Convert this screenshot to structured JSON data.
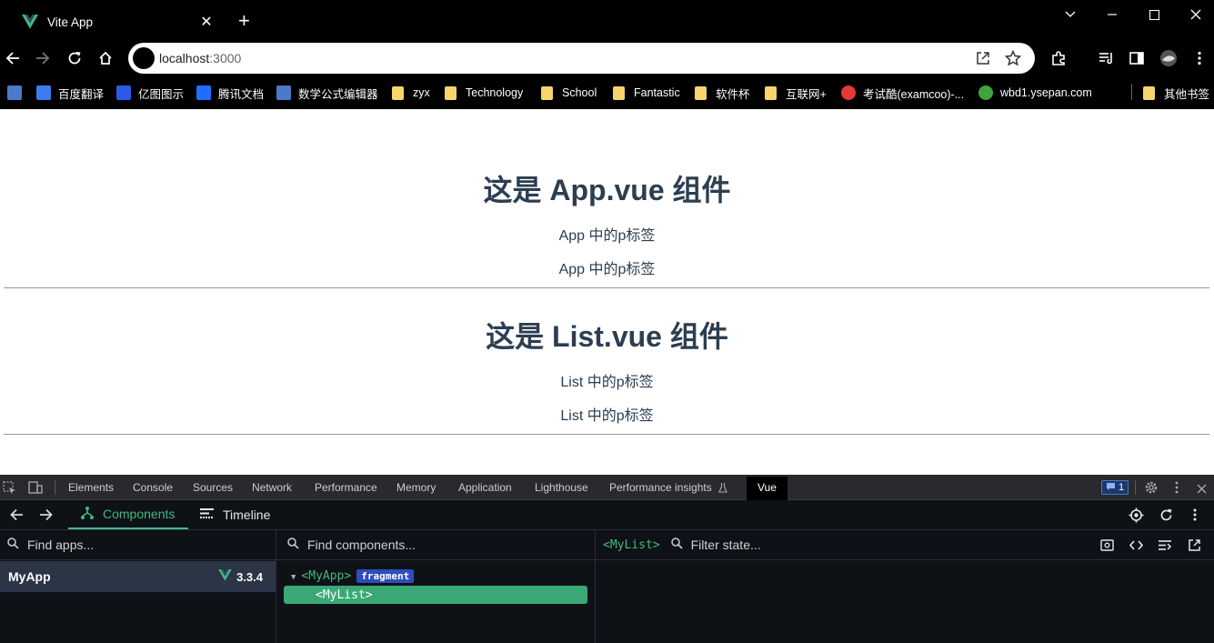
{
  "tab": {
    "title": "Vite App",
    "close": "✕",
    "new_tab": "+"
  },
  "address": {
    "host": "localhost",
    "port": ":3000"
  },
  "bookmarks": [
    {
      "label": "百度翻译",
      "icon": "baidu-translate-icon",
      "color": "#3a7df0"
    },
    {
      "label": "亿图图示",
      "icon": "edraw-icon",
      "color": "#2b5be8"
    },
    {
      "label": "腾讯文档",
      "icon": "tencent-docs-icon",
      "color": "#1e6fff"
    },
    {
      "label": "数学公式编辑器",
      "icon": "math-editor-icon",
      "color": "#4a7ac9"
    },
    {
      "label": "zyx",
      "icon": "folder-icon"
    },
    {
      "label": "Technology",
      "icon": "folder-icon"
    },
    {
      "label": "School",
      "icon": "folder-icon"
    },
    {
      "label": "Fantastic",
      "icon": "folder-icon"
    },
    {
      "label": "软件杯",
      "icon": "folder-icon"
    },
    {
      "label": "互联网+",
      "icon": "folder-icon"
    },
    {
      "label": "考试酷(examcoo)-...",
      "icon": "examcoo-icon",
      "color": "#e53935"
    },
    {
      "label": "wbd1.ysepan.com",
      "icon": "ysepan-icon",
      "color": "#3ea53e"
    },
    {
      "label": "其他书签",
      "icon": "folder-icon"
    }
  ],
  "page": {
    "app_heading": "这是 App.vue 组件",
    "app_p1": "App 中的p标签",
    "app_p2": "App 中的p标签",
    "list_heading": "这是 List.vue 组件",
    "list_p1": "List 中的p标签",
    "list_p2": "List 中的p标签"
  },
  "devtools": {
    "tabs": [
      "Elements",
      "Console",
      "Sources",
      "Network",
      "Performance",
      "Memory",
      "Application",
      "Lighthouse",
      "Performance insights"
    ],
    "active_tab": "Vue",
    "issues_count": "1",
    "vue_tabs": {
      "components": "Components",
      "timeline": "Timeline"
    },
    "find_apps_placeholder": "Find apps...",
    "find_components_placeholder": "Find components...",
    "filter_state_placeholder": "Filter state...",
    "selected_component": "<MyList>",
    "app": {
      "name": "MyApp",
      "version": "3.3.4"
    },
    "tree": {
      "root": "<MyApp>",
      "root_badge": "fragment",
      "child": "<MyList>"
    }
  },
  "colors": {
    "vue_green": "#42b883",
    "page_text": "#2c3e50",
    "selected_row": "#3aa876"
  }
}
